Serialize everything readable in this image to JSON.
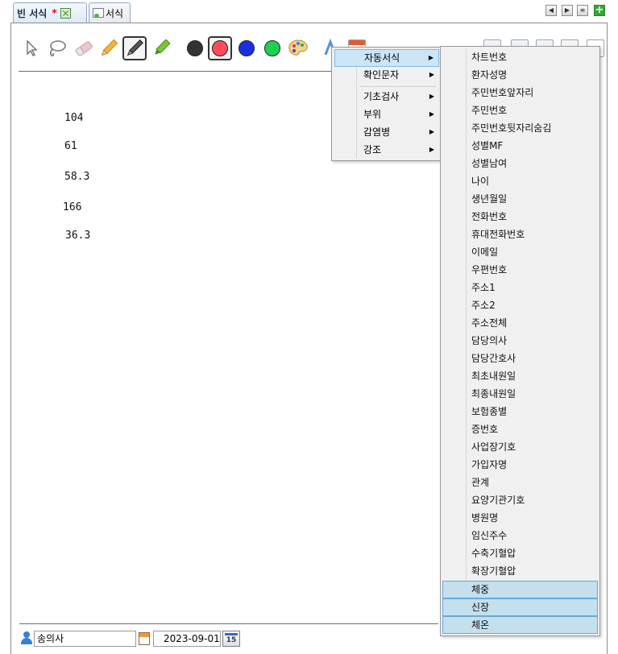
{
  "tabs": [
    {
      "label": "빈 서식",
      "modified_mark": "*",
      "active": true
    },
    {
      "label": "서식",
      "active": false
    }
  ],
  "toolbar": {
    "tools": [
      "pointer-tool",
      "lasso-tool",
      "eraser-tool",
      "pencil-tool",
      "pen-tool",
      "marker-tool"
    ],
    "colors": [
      "#333333",
      "#ff4b5a",
      "#1830e0",
      "#1fd050"
    ],
    "selected_color": "#ff4b5a"
  },
  "canvas": {
    "values": [
      "104",
      "61",
      "58.3",
      "166",
      "36.3"
    ]
  },
  "context_menu": {
    "items": [
      {
        "label": "자동서식",
        "has_submenu": true
      },
      {
        "label": "확인문자",
        "has_submenu": true
      },
      {
        "label": "기초검사",
        "has_submenu": true
      },
      {
        "label": "부위",
        "has_submenu": true
      },
      {
        "label": "감염병",
        "has_submenu": true
      },
      {
        "label": "강조",
        "has_submenu": true
      }
    ],
    "submenu_items": [
      "차트번호",
      "환자성명",
      "주민번호앞자리",
      "주민번호",
      "주민번호뒷자리숨김",
      "성별MF",
      "성별남여",
      "나이",
      "생년월일",
      "전화번호",
      "휴대전화번호",
      "이메일",
      "우편번호",
      "주소1",
      "주소2",
      "주소전체",
      "담당의사",
      "담당간호사",
      "최초내원일",
      "최종내원일",
      "보험종별",
      "증번호",
      "사업장기호",
      "가입자명",
      "관계",
      "요양기관기호",
      "병원명",
      "임신주수",
      "수축기혈압",
      "확장기혈압",
      "체중",
      "신장",
      "체온"
    ],
    "highlighted_submenu_items": [
      "체중",
      "신장",
      "체온"
    ]
  },
  "footer": {
    "doctor": "송의사",
    "date": "2023-09-01",
    "calendar_day": "15"
  }
}
